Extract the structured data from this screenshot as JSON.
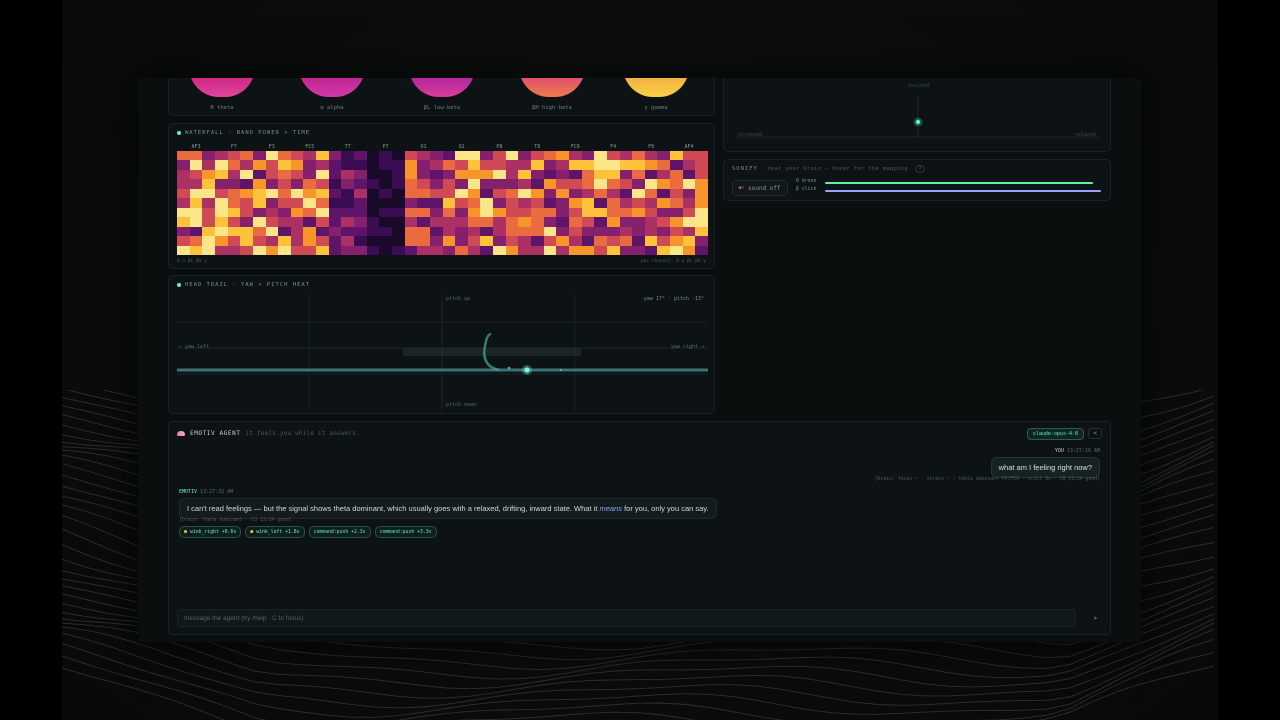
{
  "bands": [
    {
      "label": "θ theta",
      "color_top": "#c2187a",
      "color_bottom": "#e1459c"
    },
    {
      "label": "α alpha",
      "color_top": "#b21a8e",
      "color_bottom": "#d43aa4"
    },
    {
      "label": "βL low-beta",
      "color_top": "#a318a0",
      "color_bottom": "#d53e9b"
    },
    {
      "label": "βH high-beta",
      "color_top": "#d43a7e",
      "color_bottom": "#f07a4a"
    },
    {
      "label": "γ gamma",
      "color_top": "#f0a03a",
      "color_bottom": "#f8d04a"
    }
  ],
  "waterfall": {
    "title": "WATERFALL · BAND POWER × TIME",
    "channels": [
      "AF3",
      "F7",
      "F3",
      "FC5",
      "T7",
      "P7",
      "O1",
      "O2",
      "P8",
      "T8",
      "FC6",
      "F4",
      "F8",
      "AF4"
    ],
    "axis_label": "θ α βL βH γ",
    "footer": "per channel: θ α βL βH γ"
  },
  "head_trail": {
    "title": "HEAD TRAIL · YAW × PITCH HEAT",
    "pitch_up": "pitch up",
    "pitch_down": "pitch down",
    "yaw_left": "← yaw left",
    "yaw_right": "yaw right →",
    "readout": "yaw 17° · pitch -13°"
  },
  "gauge": {
    "top_label": "excited",
    "left_label": "stressed",
    "right_label": "relaxed"
  },
  "sonify": {
    "title": "SONIFY",
    "subtitle": "hear your brain — hover for the mapping",
    "help": "?",
    "sound_button": "sound off",
    "drone_label": "θ drone",
    "click_label": "β click",
    "drone_level": 0.97,
    "click_level": 1.0,
    "colors": {
      "drone": "#5ff0a8",
      "click": "#9aa0ff"
    }
  },
  "agent": {
    "title": "EMOTIV AGENT",
    "subtitle": "it feels you while it answers",
    "model": "claude-opus-4-8",
    "menu": "<",
    "user_name": "YOU",
    "user_time": "13:27:16 AM",
    "user_message": "what am I feeling right now?",
    "user_context": "[brain: focus ~ · stress ~ · theta dominant FP/FC6 · still 3s · CQ 13/14 good]",
    "ai_name": "EMOTIV",
    "ai_time": "13:27:32 AM",
    "ai_message_before": "I can't read feelings — but the signal shows theta dominant, which usually goes with a relaxed, drifting, inward state. What it ",
    "ai_message_emphasis": "means",
    "ai_message_after": " for you, only you can say.",
    "ai_context": "[brain: theta dominant · CQ 13/14 good]",
    "events": [
      {
        "label": "wink_right +0.6s",
        "emoji": true
      },
      {
        "label": "wink_left +1.8s",
        "emoji": true
      },
      {
        "label": "command:push +2.3s",
        "emoji": false
      },
      {
        "label": "command:push +3.3s",
        "emoji": false
      }
    ],
    "composer_placeholder": "message the agent (try /help · C to focus)",
    "send_icon": "➤"
  }
}
